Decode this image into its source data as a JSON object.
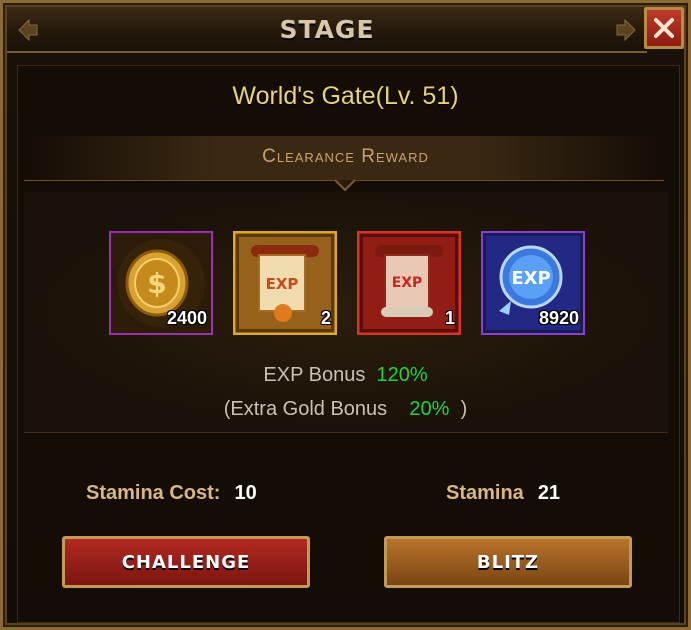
{
  "window": {
    "title": "STAGE"
  },
  "stage": {
    "name": "World's Gate(Lv. 51)"
  },
  "reward": {
    "title": "Clearance Reward"
  },
  "items": [
    {
      "icon": "gold-coin-icon",
      "count": "2400",
      "border": "#9b2fb0"
    },
    {
      "icon": "exp-scroll-gold-icon",
      "count": "2",
      "border": "#e0a82a"
    },
    {
      "icon": "exp-scroll-red-icon",
      "count": "1",
      "border": "#d8342a"
    },
    {
      "icon": "exp-orb-icon",
      "count": "8920",
      "border": "#8d3fd0"
    }
  ],
  "bonus": {
    "exp_label": "EXP Bonus",
    "exp_value": "120%",
    "gold_prefix": "(Extra Gold Bonus",
    "gold_value": "20%",
    "gold_suffix": ")"
  },
  "stats": {
    "cost_label": "Stamina Cost:",
    "cost_value": "10",
    "stamina_label": "Stamina",
    "stamina_value": "21"
  },
  "buttons": {
    "challenge": "CHALLENGE",
    "blitz": "BLITZ"
  },
  "colors": {
    "bonus_green": "#22d43c",
    "stage_name": "#e6d37a",
    "challenge": "#b22a22",
    "blitz": "#b8742a"
  }
}
